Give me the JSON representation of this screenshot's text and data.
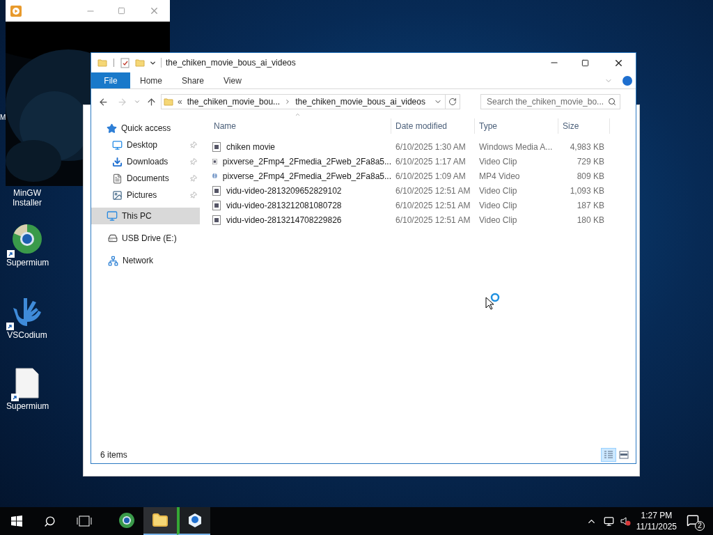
{
  "desktop": {
    "edge_text": "M",
    "icons": [
      {
        "label": "MinGW Installer"
      },
      {
        "label": "Supermium"
      },
      {
        "label": "VSCodium"
      },
      {
        "label": "Supermium"
      }
    ]
  },
  "explorer": {
    "title": "the_chiken_movie_bous_ai_videos",
    "ribbon_tabs": [
      {
        "label": "File",
        "selected": true
      },
      {
        "label": "Home",
        "selected": false
      },
      {
        "label": "Share",
        "selected": false
      },
      {
        "label": "View",
        "selected": false
      }
    ],
    "address": {
      "overflow": "«",
      "segments": [
        "the_chiken_movie_bou...",
        "the_chiken_movie_bous_ai_videos"
      ]
    },
    "search": {
      "placeholder": "Search the_chiken_movie_bo..."
    },
    "nav": [
      {
        "label": "Quick access",
        "selected": false,
        "children": [
          {
            "label": "Desktop",
            "pinned": true,
            "selected": false
          },
          {
            "label": "Downloads",
            "pinned": true,
            "selected": false
          },
          {
            "label": "Documents",
            "pinned": true,
            "selected": false
          },
          {
            "label": "Pictures",
            "pinned": true,
            "selected": false
          }
        ]
      },
      {
        "label": "This PC",
        "selected": true
      },
      {
        "label": "USB Drive (E:)",
        "selected": false
      },
      {
        "label": "Network",
        "selected": false
      }
    ],
    "columns": [
      "Name",
      "Date modified",
      "Type",
      "Size"
    ],
    "rows": [
      {
        "name": "chiken movie",
        "date": "6/10/2025 1:30 AM",
        "type": "Windows Media A...",
        "size": "4,983 KB"
      },
      {
        "name": "pixverse_2Fmp4_2Fmedia_2Fweb_2Fa8a5...",
        "date": "6/10/2025 1:17 AM",
        "type": "Video Clip",
        "size": "729 KB"
      },
      {
        "name": "pixverse_2Fmp4_2Fmedia_2Fweb_2Fa8a5...",
        "date": "6/10/2025 1:09 AM",
        "type": "MP4 Video",
        "size": "809 KB"
      },
      {
        "name": "vidu-video-2813209652829102",
        "date": "6/10/2025 12:51 AM",
        "type": "Video Clip",
        "size": "1,093 KB"
      },
      {
        "name": "vidu-video-2813212081080728",
        "date": "6/10/2025 12:51 AM",
        "type": "Video Clip",
        "size": "187 KB"
      },
      {
        "name": "vidu-video-2813214708229826",
        "date": "6/10/2025 12:51 AM",
        "type": "Video Clip",
        "size": "180 KB"
      }
    ],
    "status": "6 items",
    "views": [
      {
        "selected": true
      },
      {
        "selected": false
      }
    ]
  },
  "taskbar": {
    "apps": [
      {
        "selected": false
      },
      {
        "selected": true
      },
      {
        "selected": false
      }
    ],
    "time": "1:27 PM",
    "date": "11/11/2025",
    "notifications": "2"
  }
}
